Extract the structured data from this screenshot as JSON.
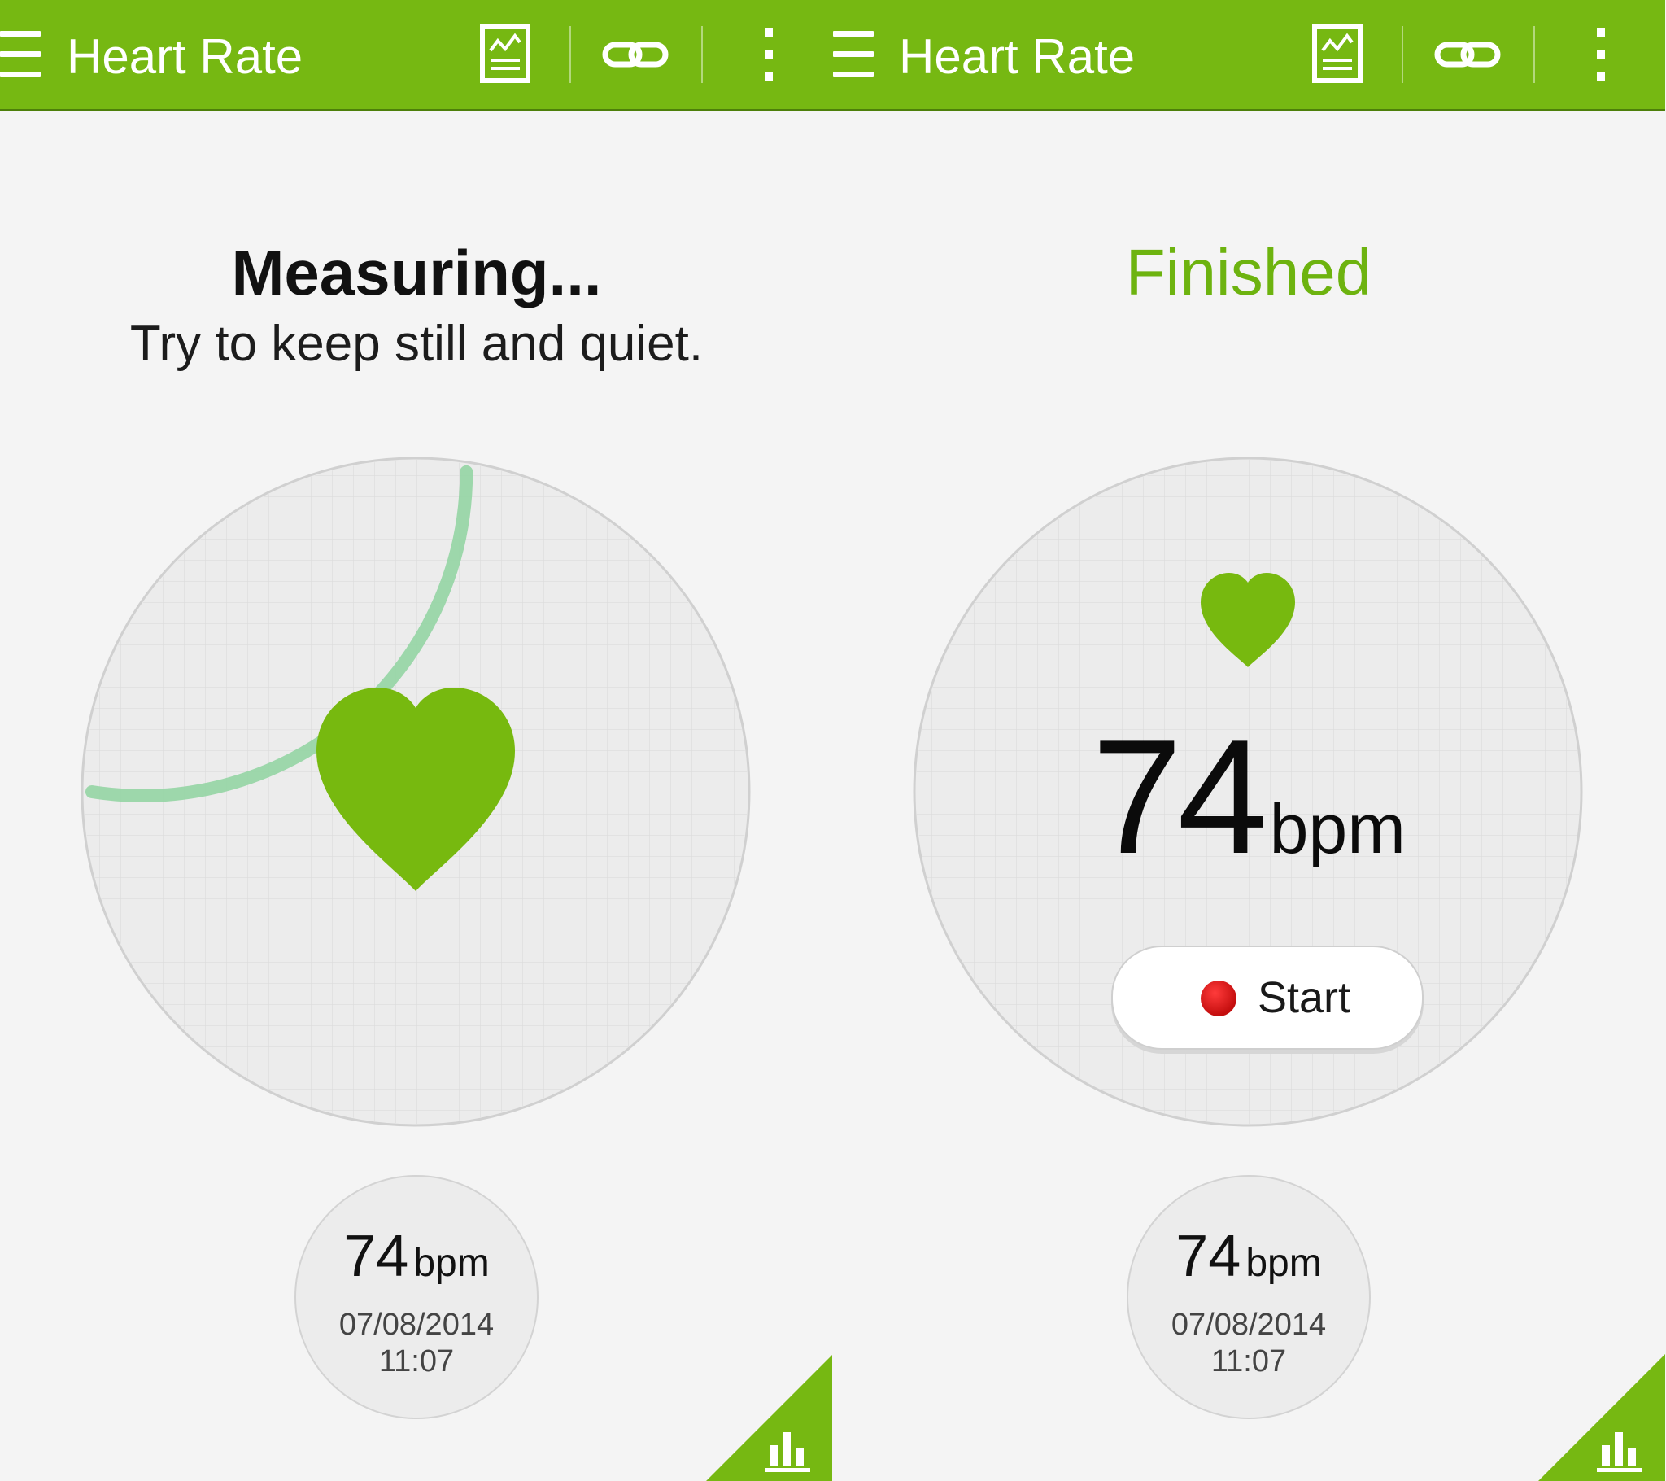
{
  "colors": {
    "brand_green": "#76b812",
    "finished_green": "#6db30f",
    "heart_green": "#77b90f",
    "progress_green": "#8fd4a0",
    "start_dot_red": "#d91414"
  },
  "icons": {
    "menu": "hamburger-menu-icon",
    "chart": "report-chart-icon",
    "link": "chain-link-icon",
    "more": "more-vertical-icon",
    "heart": "heart-icon",
    "history": "bar-chart-icon"
  },
  "panels": [
    {
      "state": "measuring",
      "app_bar": {
        "title": "Heart Rate"
      },
      "status_title": "Measuring...",
      "status_subtitle": "Try to keep still and quiet.",
      "progress_fraction": 0.55,
      "history": {
        "value": "74",
        "unit": "bpm",
        "date": "07/08/2014",
        "time": "11:07"
      }
    },
    {
      "state": "finished",
      "app_bar": {
        "title": "Heart Rate"
      },
      "status_title": "Finished",
      "result": {
        "value": "74",
        "unit": "bpm"
      },
      "start_button": {
        "label": "Start"
      },
      "history": {
        "value": "74",
        "unit": "bpm",
        "date": "07/08/2014",
        "time": "11:07"
      }
    }
  ]
}
